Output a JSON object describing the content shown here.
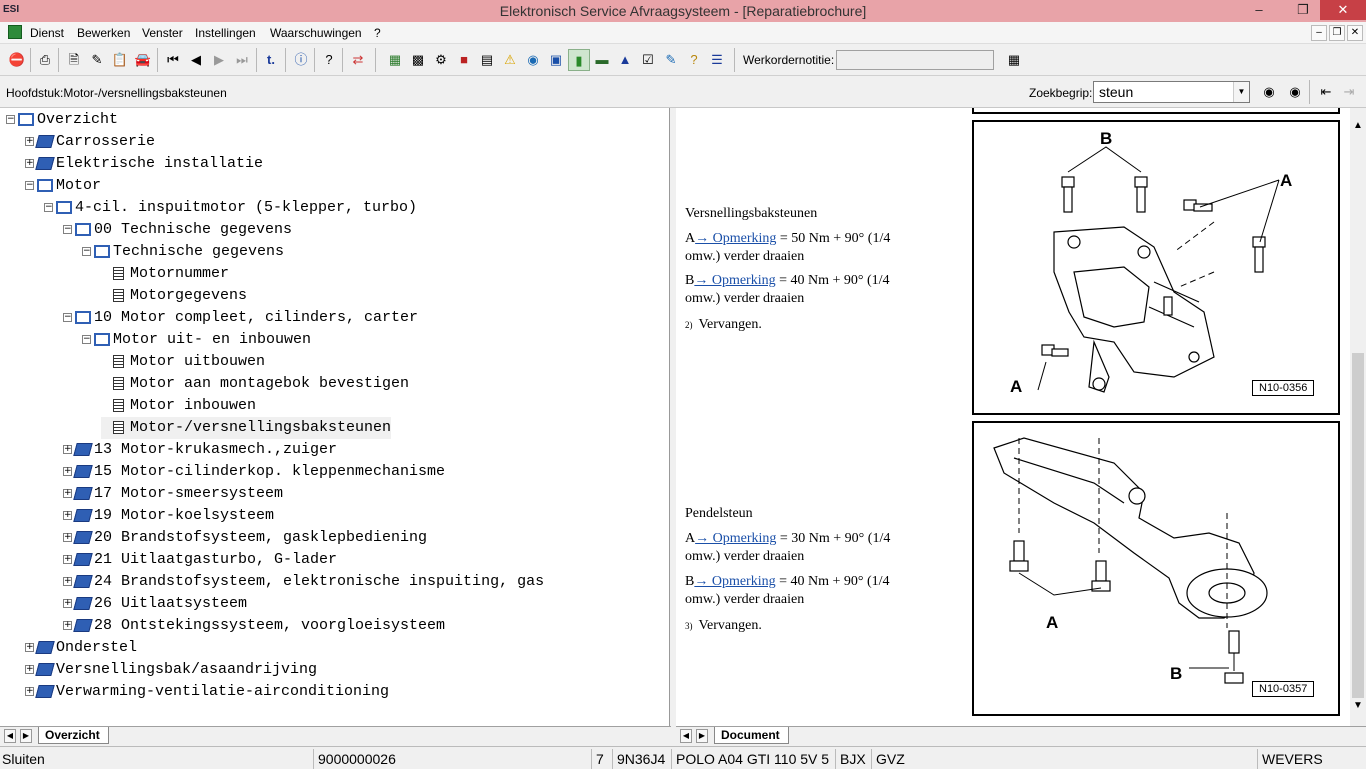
{
  "window": {
    "title": "Elektronisch Service Afvraagsysteem - [Reparatiebrochure]"
  },
  "menu": [
    "Dienst",
    "Bewerken",
    "Venster",
    "Instellingen",
    "Waarschuwingen",
    "?"
  ],
  "toolbar": {
    "workorder_label": "Werkordernotitie:"
  },
  "search": {
    "chapter": "Hoofdstuk:Motor-/versnellingsbaksteunen",
    "label": "Zoekbegrip:",
    "value": "steun"
  },
  "tree": [
    {
      "label": "Overzicht",
      "level": 0,
      "icon": "open",
      "exp": "-"
    },
    {
      "label": "Carrosserie",
      "level": 1,
      "icon": "closed",
      "exp": "+"
    },
    {
      "label": "Elektrische installatie",
      "level": 1,
      "icon": "closed",
      "exp": "+"
    },
    {
      "label": "Motor",
      "level": 1,
      "icon": "open",
      "exp": "-"
    },
    {
      "label": "4-cil. inspuitmotor (5-klepper, turbo)",
      "level": 2,
      "icon": "open",
      "exp": "-"
    },
    {
      "label": "00 Technische gegevens",
      "level": 3,
      "icon": "open",
      "exp": "-"
    },
    {
      "label": "Technische gegevens",
      "level": 4,
      "icon": "open",
      "exp": "-"
    },
    {
      "label": "Motornummer",
      "level": 5,
      "icon": "doc",
      "exp": ""
    },
    {
      "label": "Motorgegevens",
      "level": 5,
      "icon": "doc",
      "exp": ""
    },
    {
      "label": "10 Motor compleet, cilinders, carter",
      "level": 3,
      "icon": "open",
      "exp": "-"
    },
    {
      "label": "Motor uit- en inbouwen",
      "level": 4,
      "icon": "open",
      "exp": "-"
    },
    {
      "label": "Motor uitbouwen",
      "level": 5,
      "icon": "doc",
      "exp": ""
    },
    {
      "label": "Motor aan montagebok bevestigen",
      "level": 5,
      "icon": "doc",
      "exp": ""
    },
    {
      "label": "Motor inbouwen",
      "level": 5,
      "icon": "doc",
      "exp": ""
    },
    {
      "label": "Motor-/versnellingsbaksteunen",
      "level": 5,
      "icon": "doc",
      "exp": "",
      "selected": true
    },
    {
      "label": "13 Motor-krukasmech.,zuiger",
      "level": 3,
      "icon": "closed",
      "exp": "+"
    },
    {
      "label": "15 Motor-cilinderkop. kleppenmechanisme",
      "level": 3,
      "icon": "closed",
      "exp": "+"
    },
    {
      "label": "17 Motor-smeersysteem",
      "level": 3,
      "icon": "closed",
      "exp": "+"
    },
    {
      "label": "19 Motor-koelsysteem",
      "level": 3,
      "icon": "closed",
      "exp": "+"
    },
    {
      "label": "20 Brandstofsysteem, gasklepbediening",
      "level": 3,
      "icon": "closed",
      "exp": "+"
    },
    {
      "label": "21 Uitlaatgasturbo, G-lader",
      "level": 3,
      "icon": "closed",
      "exp": "+"
    },
    {
      "label": "24 Brandstofsysteem, elektronische inspuiting, gas",
      "level": 3,
      "icon": "closed",
      "exp": "+"
    },
    {
      "label": "26 Uitlaatsysteem",
      "level": 3,
      "icon": "closed",
      "exp": "+"
    },
    {
      "label": "28 Ontstekingssysteem, voorgloeisysteem",
      "level": 3,
      "icon": "closed",
      "exp": "+"
    },
    {
      "label": "Onderstel",
      "level": 1,
      "icon": "closed",
      "exp": "+"
    },
    {
      "label": "Versnellingsbak/asaandrijving",
      "level": 1,
      "icon": "closed",
      "exp": "+"
    },
    {
      "label": "Verwarming-ventilatie-airconditioning",
      "level": 1,
      "icon": "closed",
      "exp": "+"
    }
  ],
  "tabs": {
    "left": "Overzicht",
    "right": "Document"
  },
  "document": {
    "section1": {
      "title": "Versnellingsbaksteunen",
      "lineA_prefix": "A",
      "lineA_link": "→ Opmerking",
      "lineA_text": " = 50 Nm + 90° (1/4",
      "lineA_cont": "omw.) verder draaien",
      "lineB_prefix": "B",
      "lineB_link": "→ Opmerking",
      "lineB_text": " = 40 Nm + 90° (1/4",
      "lineB_cont": "omw.) verder draaien",
      "note_num": "2)",
      "note": "Vervangen.",
      "figure": "N10-0356"
    },
    "section2": {
      "title": "Pendelsteun",
      "lineA_prefix": "A",
      "lineA_link": "→ Opmerking",
      "lineA_text": " = 30 Nm + 90° (1/4",
      "lineA_cont": "omw.) verder draaien",
      "lineB_prefix": "B",
      "lineB_link": "→ Opmerking",
      "lineB_text": " = 40 Nm + 90° (1/4",
      "lineB_cont": "omw.) verder draaien",
      "note_num": "3)",
      "note": "Vervangen.",
      "figure": "N10-0357"
    },
    "callouts": {
      "a": "A",
      "b": "B"
    }
  },
  "status": {
    "left": "Sluiten",
    "code": "9000000026",
    "num": "7",
    "vin": "9N36J4",
    "model": "POLO A04 GTI 110 5V 5",
    "engine": "BJX",
    "gear": "GVZ",
    "user": "WEVERS"
  }
}
